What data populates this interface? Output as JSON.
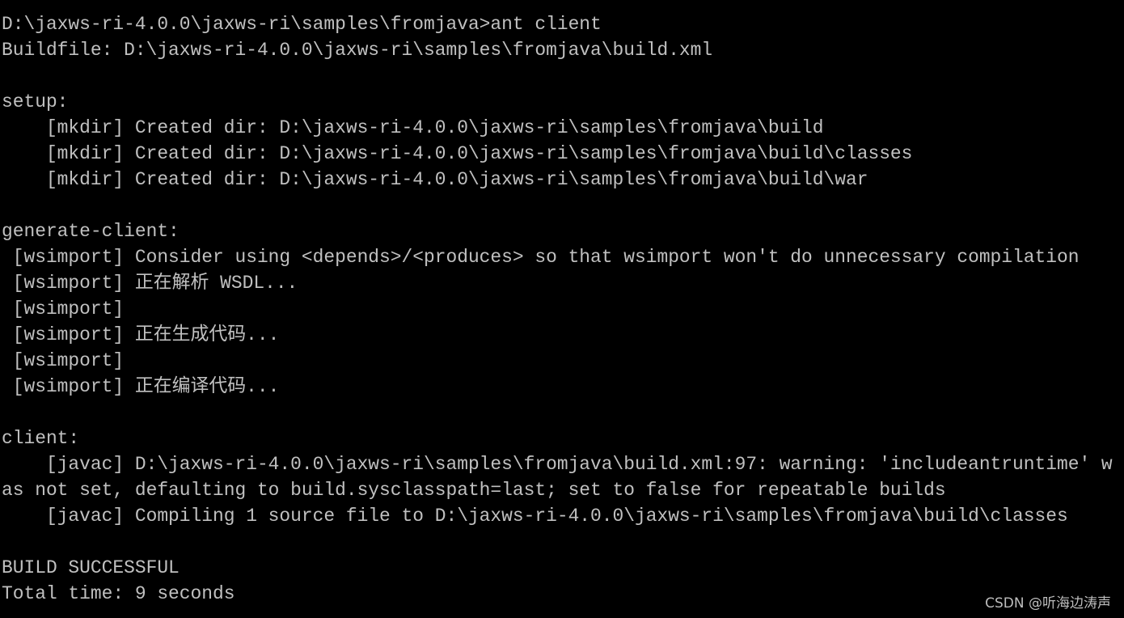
{
  "colors": {
    "background": "#000000",
    "text": "#c0c0c0"
  },
  "console": {
    "lines": [
      "D:\\jaxws-ri-4.0.0\\jaxws-ri\\samples\\fromjava>ant client",
      "Buildfile: D:\\jaxws-ri-4.0.0\\jaxws-ri\\samples\\fromjava\\build.xml",
      "",
      "setup:",
      "    [mkdir] Created dir: D:\\jaxws-ri-4.0.0\\jaxws-ri\\samples\\fromjava\\build",
      "    [mkdir] Created dir: D:\\jaxws-ri-4.0.0\\jaxws-ri\\samples\\fromjava\\build\\classes",
      "    [mkdir] Created dir: D:\\jaxws-ri-4.0.0\\jaxws-ri\\samples\\fromjava\\build\\war",
      "",
      "generate-client:",
      " [wsimport] Consider using <depends>/<produces> so that wsimport won't do unnecessary compilation",
      " [wsimport] 正在解析 WSDL...",
      " [wsimport]",
      " [wsimport] 正在生成代码...",
      " [wsimport]",
      " [wsimport] 正在编译代码...",
      "",
      "client:",
      "    [javac] D:\\jaxws-ri-4.0.0\\jaxws-ri\\samples\\fromjava\\build.xml:97: warning: 'includeantruntime' w",
      "as not set, defaulting to build.sysclasspath=last; set to false for repeatable builds",
      "    [javac] Compiling 1 source file to D:\\jaxws-ri-4.0.0\\jaxws-ri\\samples\\fromjava\\build\\classes",
      "",
      "BUILD SUCCESSFUL",
      "Total time: 9 seconds"
    ]
  },
  "watermark": "CSDN @听海边涛声"
}
